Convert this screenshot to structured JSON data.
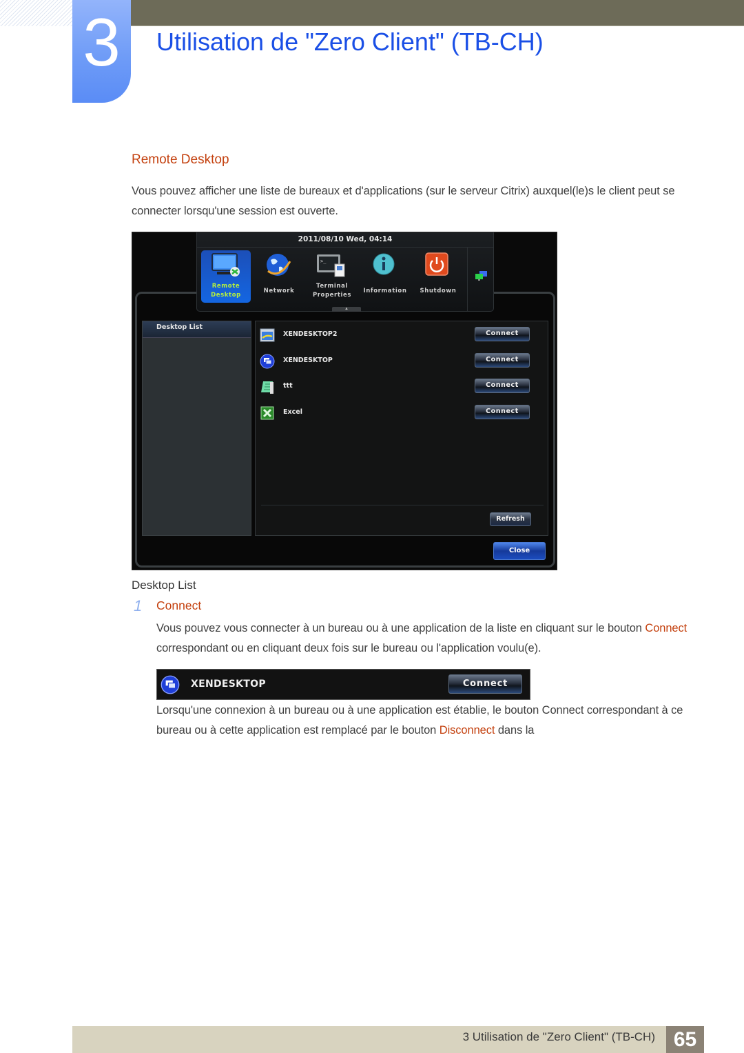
{
  "header": {
    "chapter_number": "3",
    "chapter_title": "Utilisation de \"Zero Client\" (TB-CH)"
  },
  "section": {
    "heading": "Remote Desktop",
    "intro": "Vous pouvez afficher une liste de bureaux et d'applications (sur le serveur Citrix) auxquel(le)s le client peut se connecter lorsqu'une session est ouverte."
  },
  "screenshot": {
    "datetime": "2011/08/10 Wed, 04:14",
    "menu": [
      {
        "label_line1": "Remote",
        "label_line2": "Desktop",
        "icon": "monitor-icon",
        "active": true
      },
      {
        "label_line1": "Network",
        "label_line2": "",
        "icon": "globe-icon",
        "active": false
      },
      {
        "label_line1": "Terminal",
        "label_line2": "Properties",
        "icon": "terminal-icon",
        "active": false
      },
      {
        "label_line1": "Information",
        "label_line2": "",
        "icon": "info-icon",
        "active": false
      },
      {
        "label_line1": "Shutdown",
        "label_line2": "",
        "icon": "power-icon",
        "active": false
      }
    ],
    "tray_icon": "network-monitors-icon",
    "collapse_glyph": "▲",
    "left_panel_title": "Desktop List",
    "desktops": [
      {
        "name": "XENDESKTOP2",
        "icon": "desktop-window-icon",
        "button": "Connect"
      },
      {
        "name": "XENDESKTOP",
        "icon": "xendesktop-icon",
        "button": "Connect"
      },
      {
        "name": "ttt",
        "icon": "notepad-icon",
        "button": "Connect"
      },
      {
        "name": "Excel",
        "icon": "excel-icon",
        "button": "Connect"
      }
    ],
    "refresh_label": "Refresh",
    "close_label": "Close"
  },
  "desktop_list": {
    "heading": "Desktop List",
    "step_number": "1",
    "step_title": "Connect",
    "para_part1": "Vous pouvez vous connecter à un bureau ou à une application de la liste en cliquant sur le bouton ",
    "para_highlight": "Connect",
    "para_part2": " correspondant ou en cliquant deux fois sur le bureau ou l'application voulu(e).",
    "example": {
      "name": "XENDESKTOP",
      "button": "Connect"
    },
    "para2_part1": "Lorsqu'une connexion à un bureau ou à une application est établie, le bouton Connect correspondant à ce bureau ou à cette application est remplacé par le bouton ",
    "para2_highlight": "Disconnect",
    "para2_part2": " dans la"
  },
  "footer": {
    "text": "3 Utilisation de \"Zero Client\" (TB-CH)",
    "page": "65"
  },
  "colors": {
    "title_blue": "#1a4fe6",
    "accent_orange": "#c4410f",
    "band": "#6d6b58",
    "footer_band": "#d8d3bf",
    "page_box": "#8b8275"
  }
}
